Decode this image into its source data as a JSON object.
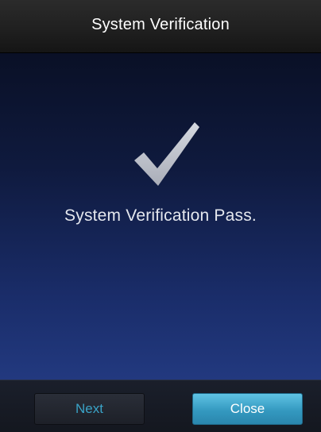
{
  "header": {
    "title": "System Verification"
  },
  "main": {
    "message": "System Verification Pass.",
    "status_icon": "checkmark-icon"
  },
  "footer": {
    "next_label": "Next",
    "close_label": "Close"
  },
  "colors": {
    "accent": "#3aa3c7",
    "close_button": "#3499c0",
    "background": "#0f1a3e",
    "checkmark": "#b8bcc6"
  }
}
